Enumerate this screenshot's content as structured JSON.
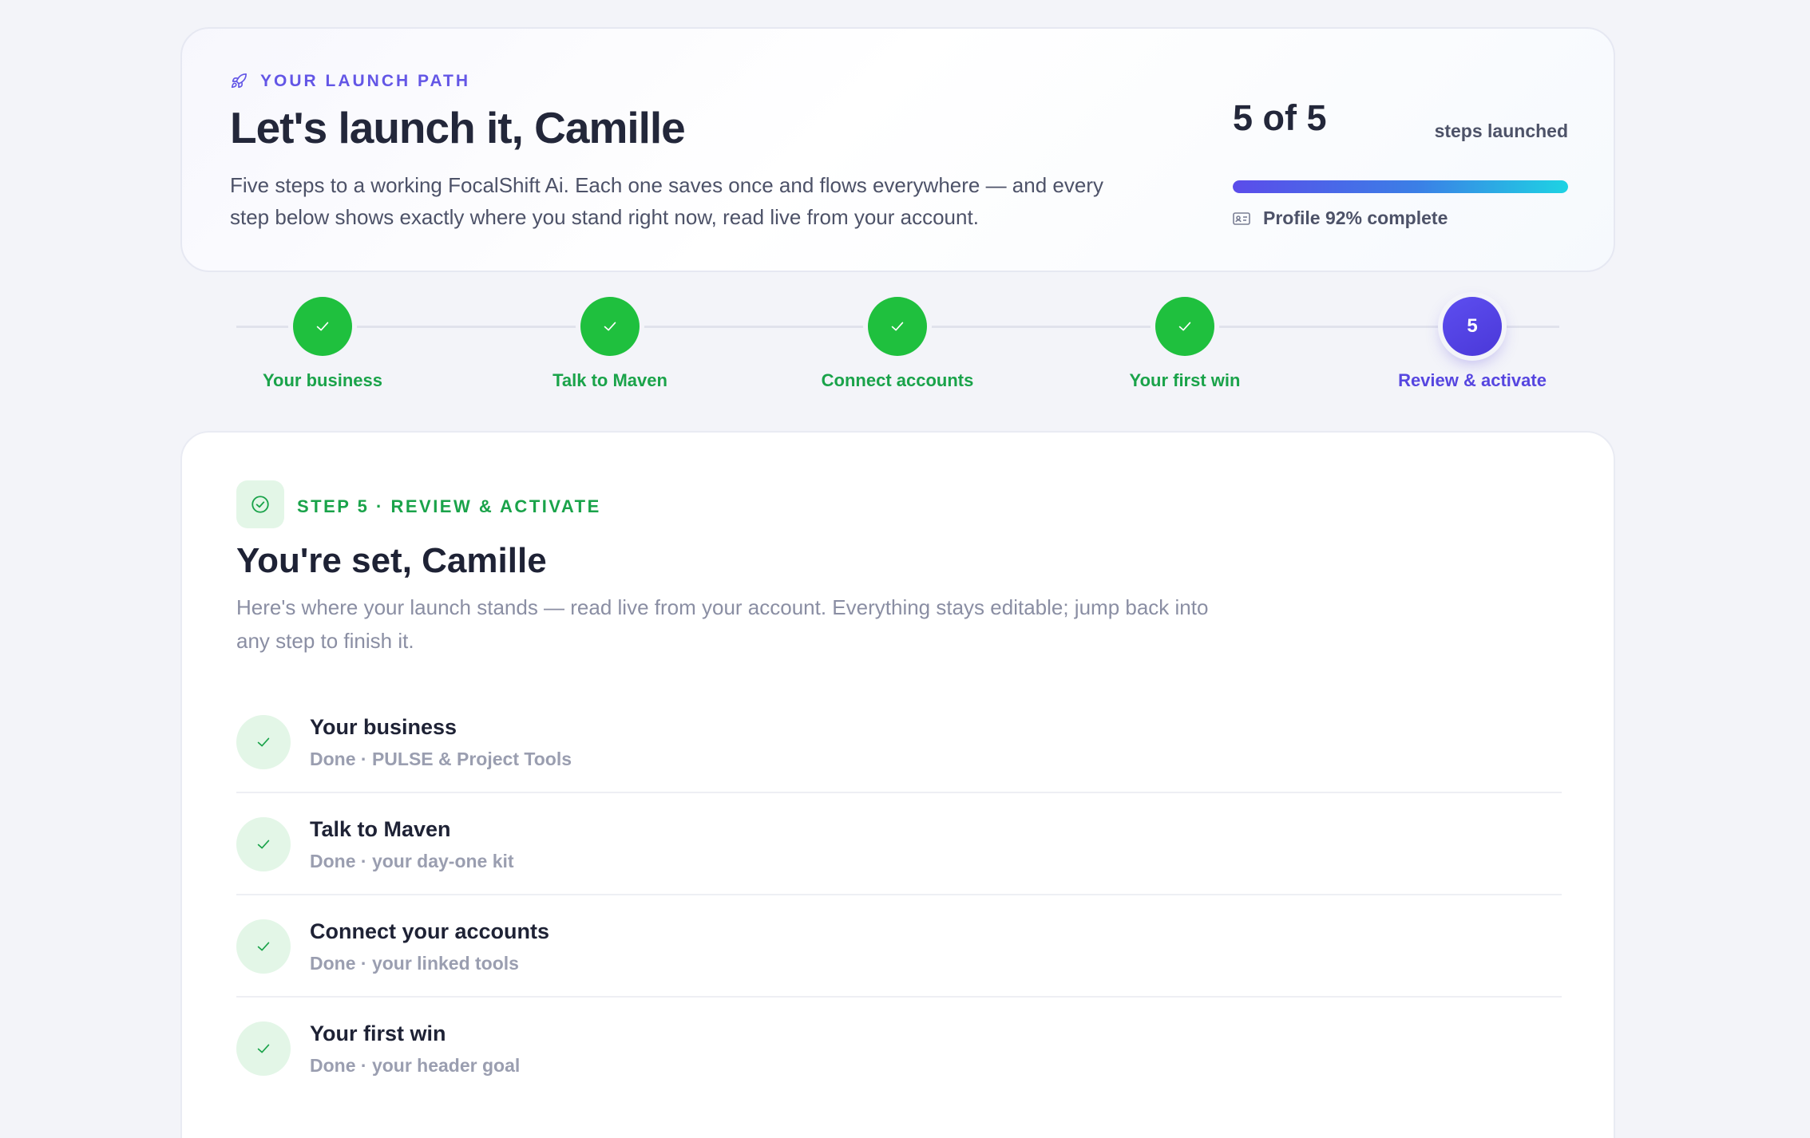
{
  "header": {
    "eyebrow": "YOUR LAUNCH PATH",
    "eyebrow_icon": "rocket-icon",
    "title": "Let's launch it, Camille",
    "subtitle": "Five steps to a working FocalShift Ai. Each one saves once and flows everywhere — and every step below shows exactly where you stand right now, read live from your account.",
    "progress": {
      "count": "5 of 5",
      "label": "steps launched",
      "fraction": 1.0,
      "profile_icon": "id-card-icon",
      "profile_text": "Profile 92% complete"
    }
  },
  "stepper": {
    "steps": [
      {
        "label": "Your business",
        "state": "done"
      },
      {
        "label": "Talk to Maven",
        "state": "done"
      },
      {
        "label": "Connect accounts",
        "state": "done"
      },
      {
        "label": "Your first win",
        "state": "done"
      },
      {
        "label": "Review & activate",
        "state": "current",
        "number": "5"
      }
    ]
  },
  "main": {
    "badge_icon": "check-circle-icon",
    "eyebrow": "STEP 5 · REVIEW & ACTIVATE",
    "title": "You're set, Camille",
    "subtitle": "Here's where your launch stands — read live from your account. Everything stays editable; jump back into any step to finish it.",
    "items": [
      {
        "title": "Your business",
        "meta": "Done · PULSE & Project Tools"
      },
      {
        "title": "Talk to Maven",
        "meta": "Done · your day-one kit"
      },
      {
        "title": "Connect your accounts",
        "meta": "Done · your linked tools"
      },
      {
        "title": "Your first win",
        "meta": "Done · your header goal"
      }
    ]
  },
  "colors": {
    "accent": "#5646e0",
    "success": "#1fc03e",
    "success_text": "#1aa34a",
    "background": "#f3f4f9"
  }
}
